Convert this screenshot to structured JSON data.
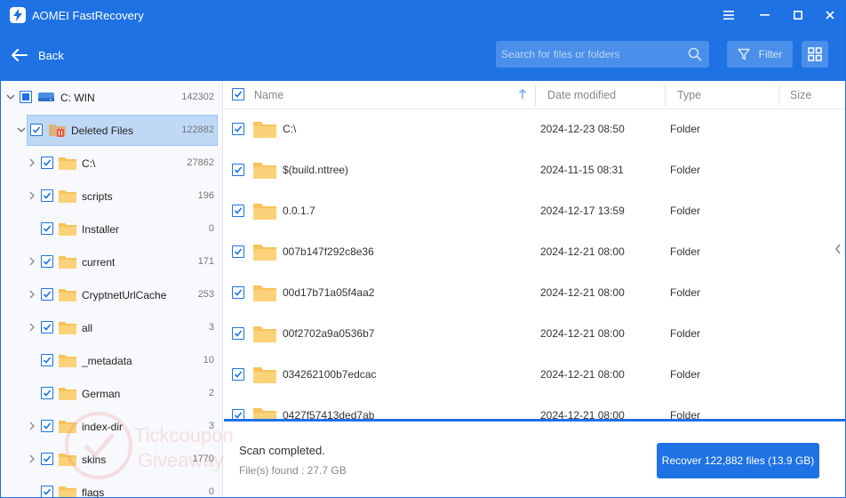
{
  "window": {
    "title": "AOMEI FastRecovery"
  },
  "header": {
    "back_label": "Back",
    "search_placeholder": "Search for files or folders",
    "filter_label": "Filter"
  },
  "tree": {
    "root": {
      "label": "C: WIN",
      "count": "142302"
    },
    "deleted": {
      "label": "Deleted Files",
      "count": "122882"
    },
    "items": [
      {
        "label": "C:\\",
        "count": "27862",
        "expandable": true
      },
      {
        "label": "scripts",
        "count": "196",
        "expandable": true
      },
      {
        "label": "Installer",
        "count": "0",
        "expandable": false
      },
      {
        "label": "current",
        "count": "171",
        "expandable": true
      },
      {
        "label": "CryptnetUrlCache",
        "count": "253",
        "expandable": true
      },
      {
        "label": "all",
        "count": "3",
        "expandable": true
      },
      {
        "label": "_metadata",
        "count": "10",
        "expandable": false
      },
      {
        "label": "German",
        "count": "2",
        "expandable": false
      },
      {
        "label": "index-dir",
        "count": "3",
        "expandable": true
      },
      {
        "label": "skins",
        "count": "1770",
        "expandable": true
      },
      {
        "label": "flags",
        "count": "0",
        "expandable": false
      }
    ]
  },
  "list": {
    "columns": {
      "name": "Name",
      "date": "Date modified",
      "type": "Type",
      "size": "Size"
    },
    "rows": [
      {
        "name": "C:\\",
        "date": "2024-12-23 08:50",
        "type": "Folder"
      },
      {
        "name": "$(build.nttree)",
        "date": "2024-11-15 08:31",
        "type": "Folder"
      },
      {
        "name": "0.0.1.7",
        "date": "2024-12-17 13:59",
        "type": "Folder"
      },
      {
        "name": "007b147f292c8e36",
        "date": "2024-12-21 08:00",
        "type": "Folder"
      },
      {
        "name": "00d17b71a05f4aa2",
        "date": "2024-12-21 08:00",
        "type": "Folder"
      },
      {
        "name": "00f2702a9a0536b7",
        "date": "2024-12-21 08:00",
        "type": "Folder"
      },
      {
        "name": "034262100b7edcac",
        "date": "2024-12-21 08:00",
        "type": "Folder"
      },
      {
        "name": "0427f57413ded7ab",
        "date": "2024-12-21 08:00",
        "type": "Folder"
      }
    ]
  },
  "status": {
    "scan": "Scan completed.",
    "files_found": "File(s) found : 27.7 GB",
    "recover_label": "Recover 122,882 files (13.9 GB)"
  },
  "watermark": {
    "line1": "Tickcoupon",
    "line2": "Giveaway"
  },
  "colors": {
    "accent": "#1e72e3",
    "folder": "#f7c35a",
    "selected": "#bfd9f5"
  }
}
